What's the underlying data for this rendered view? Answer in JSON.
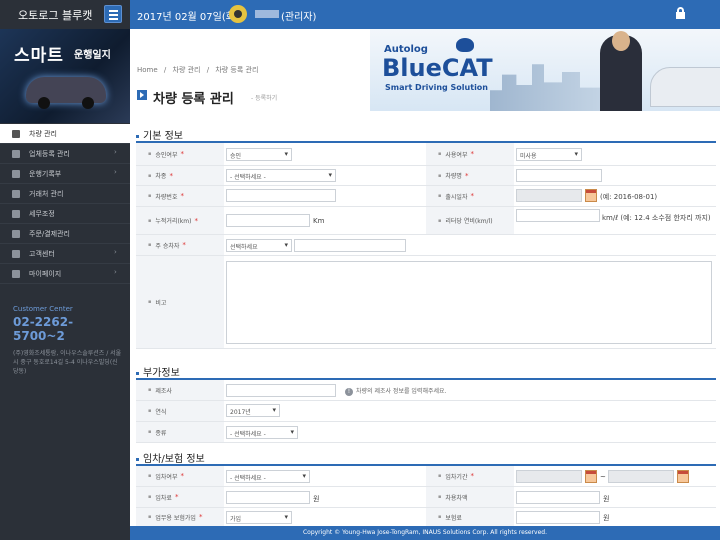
{
  "app": {
    "title": "오토로그 블루캣"
  },
  "topbar": {
    "date": "2017년 02월 07일(화)",
    "role": "(관리자)"
  },
  "sidebar": {
    "banner": {
      "title": "스마트",
      "subtitle": "운행일지"
    },
    "items": [
      {
        "label": "차량 관리",
        "active": true,
        "icon": "car-icon"
      },
      {
        "label": "업체등록 관리",
        "icon": "gear-icon",
        "chevron": true
      },
      {
        "label": "운행기록부",
        "icon": "document-icon",
        "chevron": true
      },
      {
        "label": "거래처 관리",
        "icon": "folder-icon"
      },
      {
        "label": "세무조정",
        "icon": "calculator-icon"
      },
      {
        "label": "주문/결제관리",
        "icon": "card-icon"
      },
      {
        "label": "고객센터",
        "icon": "headset-icon",
        "chevron": true
      },
      {
        "label": "마이페이지",
        "icon": "user-icon",
        "chevron": true
      }
    ],
    "customer_center": {
      "heading": "Customer Center",
      "phone": "02-2262-5700~2",
      "address": "(주)영화조세통람, 이나우스솔루션즈 / 서울시 중구 동호로14길 5-4 이나우스빌딩(신당동)"
    }
  },
  "breadcrumb": [
    "Home",
    "/",
    "차량 관리",
    "/",
    "차량 등록 관리"
  ],
  "page": {
    "title": "차량 등록 관리",
    "subtitle": "- 등록하기"
  },
  "logo": {
    "line1": "Autolog",
    "line2": "BlueCAT",
    "line3": "Smart Driving Solution"
  },
  "sections": {
    "basic": {
      "title": "기본 정보",
      "approval_label": "승인여부",
      "approval_value": "승인",
      "usage_label": "사용여부",
      "usage_value": "미사용",
      "vehicle_type_label": "차종",
      "vehicle_type_value": "- 선택하세요 -",
      "vehicle_name_label": "차량명",
      "plate_label": "차량번호",
      "release_label": "출시일자",
      "release_hint": "(예: 2016-08-01)",
      "mileage_label": "누적거리(km)",
      "mileage_unit": "Km",
      "fuel_label": "리터당 연비(km/l)",
      "fuel_hint": "km/ℓ (예: 12.4 소수점 한자리 까지)",
      "driver_label": "주 승차자",
      "driver_value": "선택하세요",
      "note_label": "비고"
    },
    "extra": {
      "title": "부가정보",
      "maker_label": "제조사",
      "maker_hint": "차량의 제조사 정보를 입력해주세요.",
      "year_label": "연식",
      "year_value": "2017년",
      "kind_label": "종류",
      "kind_value": "- 선택하세요 -"
    },
    "lease": {
      "title": "임차/보험 정보",
      "lease_label": "임차여부",
      "lease_value": "- 선택하세요 -",
      "period_label": "임차기간",
      "period_sep": "~",
      "fee_label": "임차료",
      "fee_unit": "원",
      "deposit_label": "차용차액",
      "deposit_unit": "원",
      "insurance_label": "업무용 보험가입",
      "insurance_value": "가입",
      "premium_label": "보험료",
      "premium_unit": "원"
    }
  },
  "footer": {
    "text": "Copyright © Young-Hwa Jose-TongRam, INAUS Solutions Corp. All rights reserved."
  },
  "colors": {
    "brand": "#2d6bb5",
    "sidebar": "#2b3038",
    "required": "#d33333"
  }
}
